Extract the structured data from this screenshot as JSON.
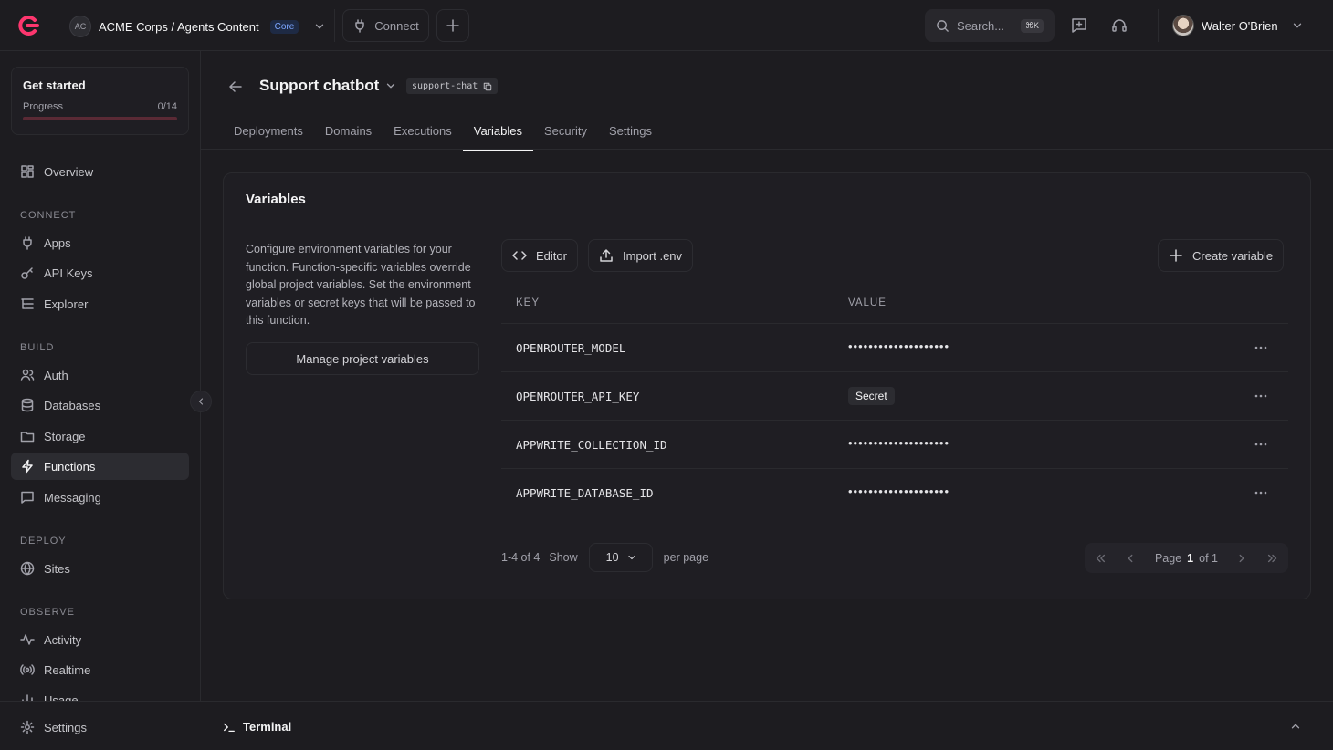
{
  "topbar": {
    "org_initials": "AC",
    "org_title": "ACME Corps / Agents Content",
    "plan_badge": "Core",
    "connect_label": "Connect",
    "search_placeholder": "Search...",
    "search_shortcut": "⌘K",
    "user_name": "Walter O'Brien"
  },
  "sidebar": {
    "get_started": {
      "title": "Get started",
      "progress_label": "Progress",
      "progress_text": "0/14",
      "progress_fraction": 0
    },
    "overview": "Overview",
    "sections": {
      "connect": "CONNECT",
      "build": "BUILD",
      "deploy": "DEPLOY",
      "observe": "OBSERVE"
    },
    "items": {
      "apps": "Apps",
      "api_keys": "API Keys",
      "explorer": "Explorer",
      "auth": "Auth",
      "databases": "Databases",
      "storage": "Storage",
      "functions": "Functions",
      "messaging": "Messaging",
      "sites": "Sites",
      "activity": "Activity",
      "realtime": "Realtime",
      "usage": "Usage",
      "settings": "Settings"
    }
  },
  "page": {
    "title": "Support chatbot",
    "slug": "support-chat",
    "tabs": [
      "Deployments",
      "Domains",
      "Executions",
      "Variables",
      "Security",
      "Settings"
    ],
    "active_tab": "Variables"
  },
  "variables": {
    "card_title": "Variables",
    "description": "Configure environment variables for your function. Function-specific variables override global project variables. Set the environment variables or secret keys that will be passed to this function.",
    "manage_label": "Manage project variables",
    "editor_label": "Editor",
    "import_label": "Import .env",
    "create_label": "Create variable",
    "columns": {
      "key": "KEY",
      "value": "VALUE"
    },
    "rows": [
      {
        "key": "OPENROUTER_MODEL",
        "value": "••••••••••••••••••••"
      },
      {
        "key": "OPENROUTER_API_KEY",
        "value": "Secret"
      },
      {
        "key": "APPWRITE_COLLECTION_ID",
        "value": "••••••••••••••••••••"
      },
      {
        "key": "APPWRITE_DATABASE_ID",
        "value": "••••••••••••••••••••"
      }
    ],
    "pagination": {
      "range": "1-4 of 4",
      "show_label": "Show",
      "per_page_value": "10",
      "per_page_label": "per page",
      "page_label": "Page",
      "current_page": "1",
      "of_label": "of 1"
    }
  },
  "terminal": {
    "label": "Terminal"
  },
  "colors": {
    "accent": "#fd366e",
    "background": "#1d1c20",
    "card": "#1f1e23"
  }
}
